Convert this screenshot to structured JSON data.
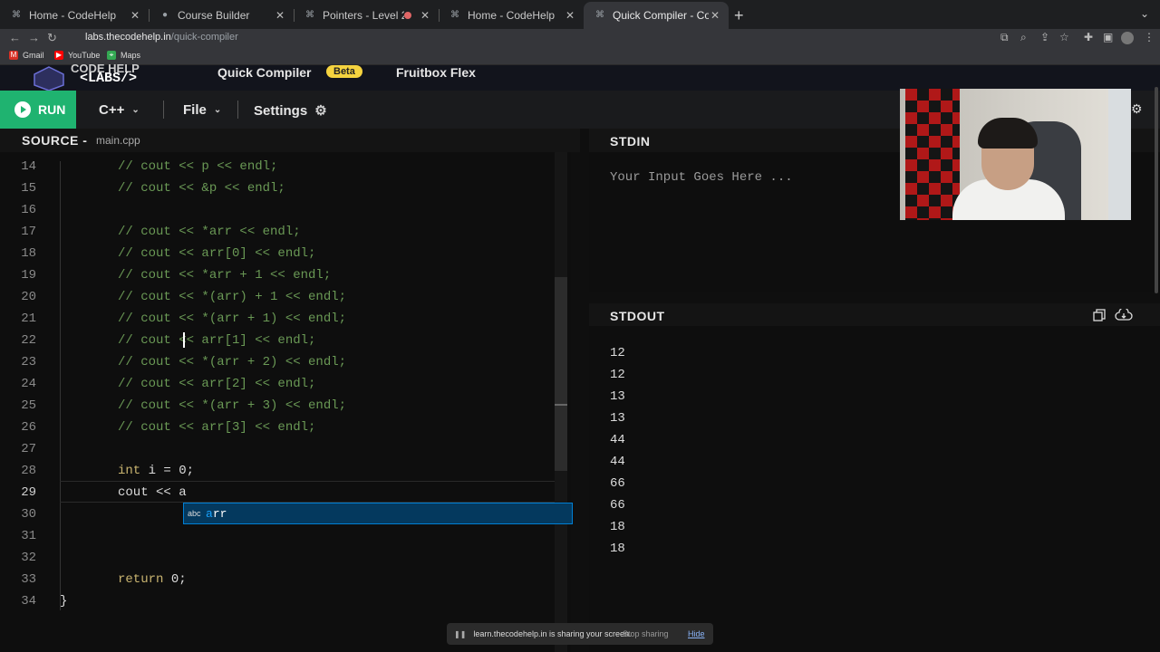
{
  "browser": {
    "tabs": [
      {
        "title": "Home - CodeHelp",
        "icon": "codehelp-favicon"
      },
      {
        "title": "Course Builder",
        "icon": "course-builder-favicon"
      },
      {
        "title": "Pointers - Level 2",
        "icon": "codehelp-favicon"
      },
      {
        "title": "Home - CodeHelp",
        "icon": "codehelp-favicon"
      },
      {
        "title": "Quick Compiler - CodeHelp La",
        "icon": "codehelp-favicon",
        "active": true
      }
    ],
    "url_host": "labs.thecodehelp.in",
    "url_path": "/quick-compiler",
    "bookmarks": [
      "Gmail",
      "YouTube",
      "Maps"
    ]
  },
  "app": {
    "logo_top": "CODE HELP",
    "logo_bottom": "<LABS/>",
    "nav": {
      "quick_compiler": "Quick Compiler",
      "beta": "Beta",
      "fruitbox": "Fruitbox Flex"
    }
  },
  "toolbar": {
    "run_label": "RUN",
    "language": "C++",
    "file_label": "File",
    "settings_label": "Settings"
  },
  "source": {
    "title": "SOURCE -",
    "filename": "main.cpp",
    "lines": [
      {
        "n": "14",
        "text": "// cout << p << endl;",
        "comment": true
      },
      {
        "n": "15",
        "text": "// cout << &p << endl;",
        "comment": true
      },
      {
        "n": "16",
        "text": "",
        "comment": false
      },
      {
        "n": "17",
        "text": "// cout << *arr << endl;",
        "comment": true
      },
      {
        "n": "18",
        "text": "// cout << arr[0] << endl;",
        "comment": true
      },
      {
        "n": "19",
        "text": "// cout << *arr + 1 << endl;",
        "comment": true
      },
      {
        "n": "20",
        "text": "// cout << *(arr) + 1 << endl;",
        "comment": true
      },
      {
        "n": "21",
        "text": "// cout << *(arr + 1) << endl;",
        "comment": true
      },
      {
        "n": "22",
        "text": "// cout << arr[1] << endl;",
        "comment": true
      },
      {
        "n": "23",
        "text": "// cout << *(arr + 2) << endl;",
        "comment": true
      },
      {
        "n": "24",
        "text": "// cout << arr[2] << endl;",
        "comment": true
      },
      {
        "n": "25",
        "text": "// cout << *(arr + 3) << endl;",
        "comment": true
      },
      {
        "n": "26",
        "text": "// cout << arr[3] << endl;",
        "comment": true
      },
      {
        "n": "27",
        "text": "",
        "comment": false
      },
      {
        "n": "28",
        "text": "int i = 0;",
        "comment": false
      },
      {
        "n": "29",
        "text": "cout << a",
        "comment": false
      },
      {
        "n": "30",
        "text": "",
        "comment": false
      },
      {
        "n": "31",
        "text": "",
        "comment": false
      },
      {
        "n": "32",
        "text": "",
        "comment": false
      },
      {
        "n": "33",
        "text": "return 0;",
        "comment": false
      },
      {
        "n": "34",
        "text": "}",
        "comment": false
      }
    ],
    "autocomplete": {
      "type": "abc",
      "match": "a",
      "rest": "rr"
    }
  },
  "stdin": {
    "title": "STDIN",
    "placeholder": "Your Input Goes Here ..."
  },
  "stdout": {
    "title": "STDOUT",
    "lines": [
      "12",
      "12",
      "13",
      "13",
      "44",
      "44",
      "66",
      "66",
      "18",
      "18"
    ]
  },
  "share_banner": {
    "message": "learn.thecodehelp.in is sharing your screen.",
    "stop": "Stop sharing",
    "hide": "Hide"
  }
}
